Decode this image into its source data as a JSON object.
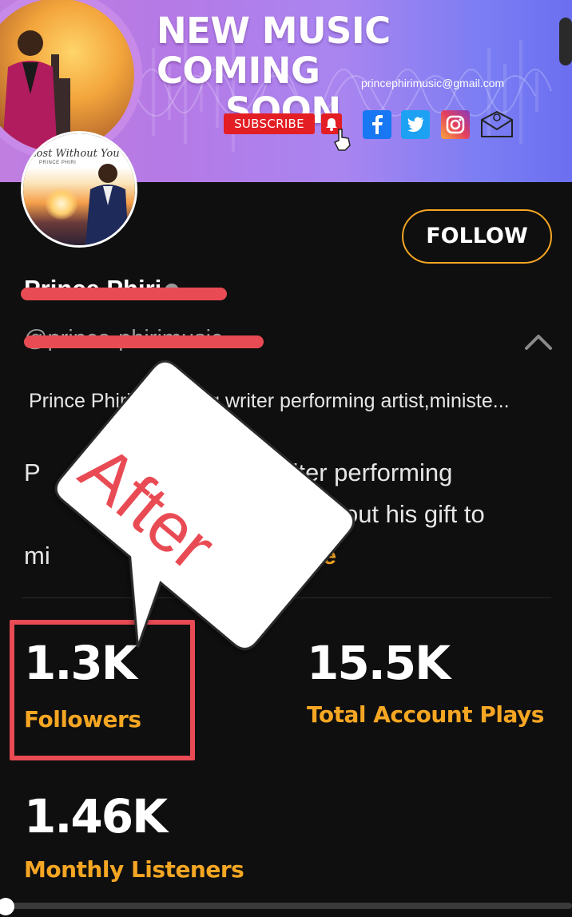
{
  "banner": {
    "title_line1": "NEW MUSIC COMING",
    "title_line2": "SOON",
    "email": "princephirimusic@gmail.com",
    "subscribe_label": "SUBSCRIBE",
    "social_icons": [
      "facebook-icon",
      "twitter-icon",
      "instagram-icon",
      "email-icon"
    ]
  },
  "avatar": {
    "cover_title": "Lost Without You",
    "cover_artist": "PRINCE PHIRI"
  },
  "profile": {
    "name": "Prince Phiri",
    "handle": "@prince-phirimusic",
    "follow_label": "FOLLOW",
    "bio_short": "Prince Phiri is a Song writer performing artist,ministe...",
    "bio_long_a": "P",
    "bio_long_b": "ng writer performing",
    "bio_long_c": "te about his gift to",
    "bio_long_d": "mi",
    "bio_more": "ore"
  },
  "stats": {
    "followers_value": "1.3K",
    "followers_label": "Followers",
    "plays_value": "15.5K",
    "plays_label": "Total Account Plays",
    "listeners_value": "1.46K",
    "listeners_label": "Monthly Listeners"
  },
  "sticker": {
    "text": "After"
  },
  "colors": {
    "accent": "#f5a623",
    "annotation_red": "#e94b54",
    "background": "#0f0f0f"
  }
}
